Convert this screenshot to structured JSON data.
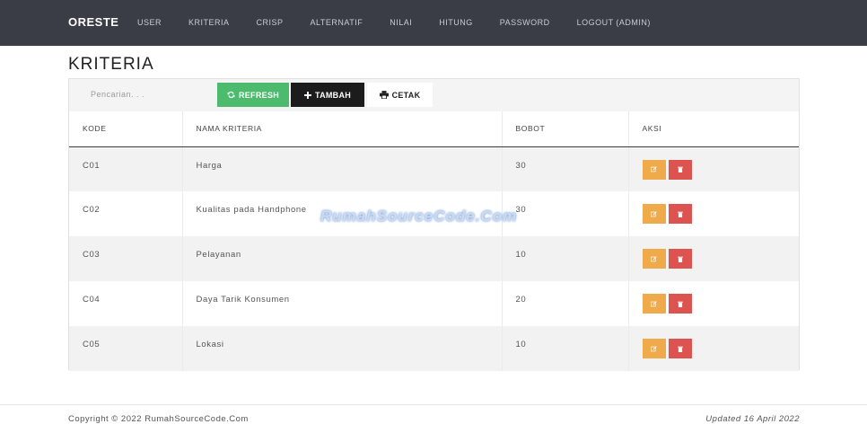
{
  "navbar": {
    "brand": "ORESTE",
    "items": [
      {
        "label": "USER"
      },
      {
        "label": "KRITERIA"
      },
      {
        "label": "CRISP"
      },
      {
        "label": "ALTERNATIF"
      },
      {
        "label": "NILAI"
      },
      {
        "label": "HITUNG"
      },
      {
        "label": "PASSWORD"
      },
      {
        "label": "LOGOUT (ADMIN)"
      }
    ]
  },
  "page": {
    "title": "KRITERIA"
  },
  "toolbar": {
    "search_placeholder": "Pencarian. . .",
    "refresh_label": "REFRESH",
    "tambah_label": "TAMBAH",
    "cetak_label": "CETAK"
  },
  "table": {
    "headers": [
      "KODE",
      "NAMA KRITERIA",
      "BOBOT",
      "AKSI"
    ],
    "rows": [
      {
        "kode": "C01",
        "nama": "Harga",
        "bobot": "30"
      },
      {
        "kode": "C02",
        "nama": "Kualitas pada Handphone",
        "bobot": "30"
      },
      {
        "kode": "C03",
        "nama": "Pelayanan",
        "bobot": "10"
      },
      {
        "kode": "C04",
        "nama": "Daya Tarik Konsumen",
        "bobot": "20"
      },
      {
        "kode": "C05",
        "nama": "Lokasi",
        "bobot": "10"
      }
    ]
  },
  "watermark": "RumahSourceCode.Com",
  "footer": {
    "copyright": "Copyright © 2022 RumahSourceCode.Com",
    "updated": "Updated 16 April 2022"
  },
  "colors": {
    "navbar": "#3a3d46",
    "refresh": "#4dbb6e",
    "tambah": "#1c1c1c",
    "edit": "#efab4b",
    "delete": "#dc5350"
  },
  "icons": {
    "refresh": "refresh-icon",
    "tambah": "plus-icon",
    "cetak": "print-icon",
    "edit": "edit-icon",
    "delete": "trash-icon"
  }
}
